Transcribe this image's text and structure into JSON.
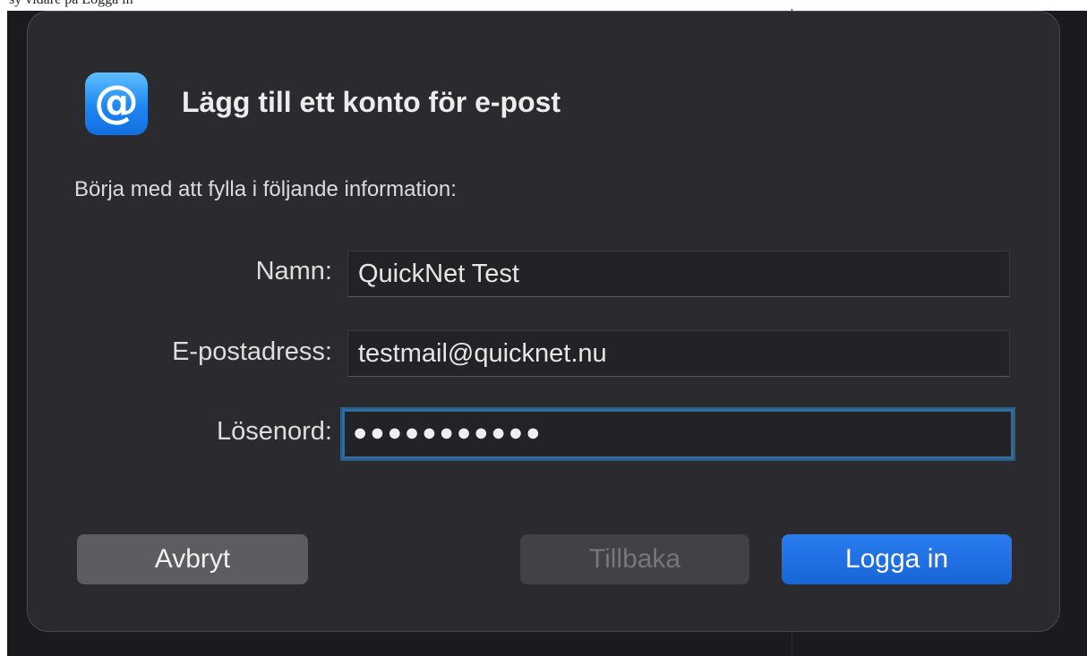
{
  "background": {
    "top_strip_text": "sy  vidare pa  Logga in"
  },
  "dialog": {
    "icon": "at-sign-icon",
    "title": "Lägg till ett konto för e-post",
    "intro": "Börja med att fylla i följande information:",
    "fields": {
      "name": {
        "label": "Namn:",
        "value": "QuickNet Test"
      },
      "email": {
        "label": "E-postadress:",
        "value": "testmail@quicknet.nu"
      },
      "password": {
        "label": "Lösenord:",
        "value": "●●●●●●●●●●●"
      }
    },
    "buttons": {
      "cancel": "Avbryt",
      "back": "Tillbaka",
      "login": "Logga in"
    }
  },
  "colors": {
    "accent": "#1a6fe0",
    "focus_ring": "#2f6d9a",
    "dialog_bg": "#2b2a2f"
  }
}
